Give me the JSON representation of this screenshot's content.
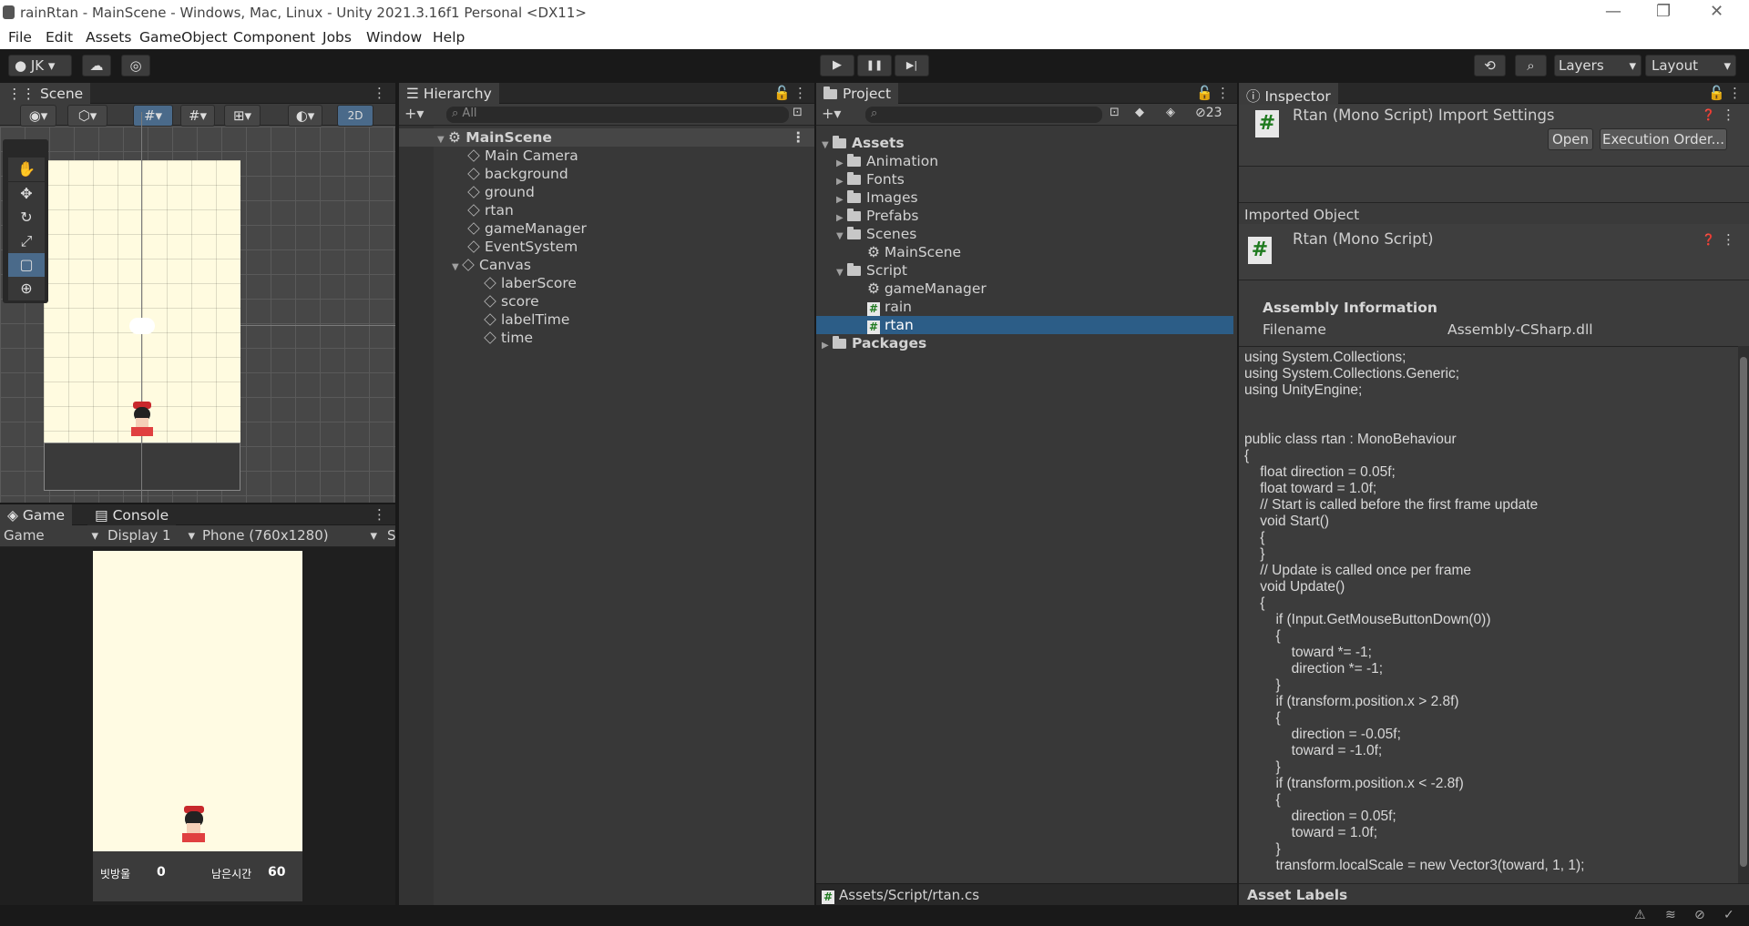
{
  "window": {
    "title": "rainRtan - MainScene - Windows, Mac, Linux - Unity 2021.3.16f1 Personal <DX11>",
    "minimize": "—",
    "maximize": "❐",
    "close": "✕"
  },
  "menu": [
    "File",
    "Edit",
    "Assets",
    "GameObject",
    "Component",
    "Jobs",
    "Window",
    "Help"
  ],
  "toolbar": {
    "account": "JK",
    "layers": "Layers",
    "layout": "Layout",
    "play": "▶",
    "pause": "❚❚",
    "step": "▶|"
  },
  "scene": {
    "tab": "Scene",
    "mode_2d": "2D"
  },
  "game": {
    "tab": "Game",
    "console_tab": "Console",
    "view": "Game",
    "display": "Display 1",
    "resolution": "Phone (760x1280)",
    "extra": "S",
    "score_label": "빗방울",
    "score_value": "0",
    "time_label": "남은시간",
    "time_value": "60"
  },
  "hierarchy": {
    "tab": "Hierarchy",
    "search_placeholder": "All",
    "scene": "MainScene",
    "items": [
      {
        "label": "Main Camera"
      },
      {
        "label": "background"
      },
      {
        "label": "ground"
      },
      {
        "label": "rtan"
      },
      {
        "label": "gameManager"
      },
      {
        "label": "EventSystem"
      },
      {
        "label": "Canvas"
      }
    ],
    "canvas_children": [
      {
        "label": "laberScore"
      },
      {
        "label": "score"
      },
      {
        "label": "labelTime"
      },
      {
        "label": "time"
      }
    ]
  },
  "project": {
    "tab": "Project",
    "hidden_count": "23",
    "assets": "Assets",
    "folders": [
      {
        "label": "Animation"
      },
      {
        "label": "Fonts"
      },
      {
        "label": "Images"
      },
      {
        "label": "Prefabs"
      },
      {
        "label": "Scenes"
      }
    ],
    "scenes_children": [
      {
        "label": "MainScene"
      }
    ],
    "script": "Script",
    "script_children": [
      {
        "label": "gameManager"
      },
      {
        "label": "rain"
      },
      {
        "label": "rtan"
      }
    ],
    "packages": "Packages",
    "path": "Assets/Script/rtan.cs"
  },
  "inspector": {
    "tab": "Inspector",
    "title": "Rtan (Mono Script) Import Settings",
    "open": "Open",
    "execution_order": "Execution Order...",
    "imported_object": "Imported Object",
    "object_name": "Rtan (Mono Script)",
    "assembly_info": "Assembly Information",
    "filename_label": "Filename",
    "filename_value": "Assembly-CSharp.dll",
    "code": "using System.Collections;\nusing System.Collections.Generic;\nusing UnityEngine;\n\n\npublic class rtan : MonoBehaviour\n{\n    float direction = 0.05f;\n    float toward = 1.0f;\n    // Start is called before the first frame update\n    void Start()\n    {\n    }\n    // Update is called once per frame\n    void Update()\n    {\n        if (Input.GetMouseButtonDown(0))\n        {\n            toward *= -1;\n            direction *= -1;\n        }\n        if (transform.position.x > 2.8f)\n        {\n            direction = -0.05f;\n            toward = -1.0f;\n        }\n        if (transform.position.x < -2.8f)\n        {\n            direction = 0.05f;\n            toward = 1.0f;\n        }\n        transform.localScale = new Vector3(toward, 1, 1);",
    "asset_labels": "Asset Labels"
  }
}
